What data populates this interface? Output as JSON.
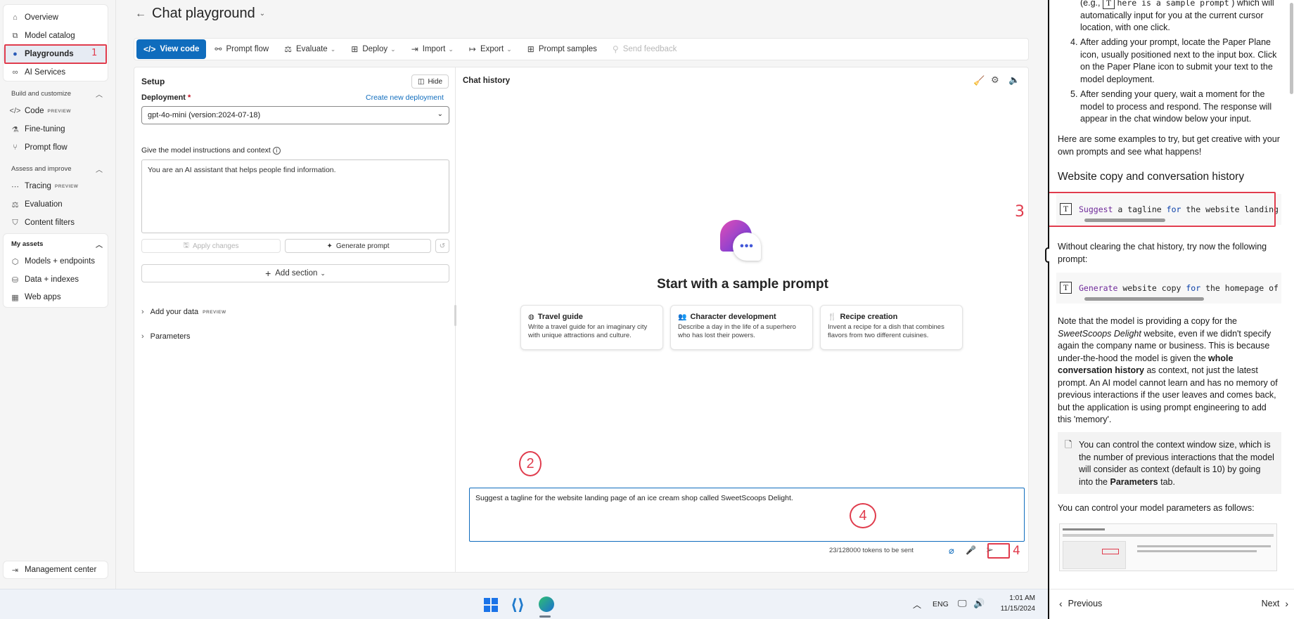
{
  "sidebar": {
    "top_items": [
      {
        "label": "Overview",
        "icon": "home-icon"
      },
      {
        "label": "Model catalog",
        "icon": "cube-icon"
      },
      {
        "label": "Playgrounds",
        "icon": "chat-bubbles-icon"
      },
      {
        "label": "AI Services",
        "icon": "link-icon"
      }
    ],
    "build_section": "Build and customize",
    "build_items": [
      {
        "label": "Code",
        "badge": "PREVIEW"
      },
      {
        "label": "Fine-tuning"
      },
      {
        "label": "Prompt flow"
      }
    ],
    "assess_section": "Assess and improve",
    "assess_items": [
      {
        "label": "Tracing",
        "badge": "PREVIEW"
      },
      {
        "label": "Evaluation"
      },
      {
        "label": "Content filters"
      }
    ],
    "assets_section": "My assets",
    "assets_items": [
      {
        "label": "Models + endpoints"
      },
      {
        "label": "Data + indexes"
      },
      {
        "label": "Web apps"
      }
    ],
    "management": "Management center"
  },
  "header": {
    "title": "Chat playground"
  },
  "toolbar": {
    "view_code": "View code",
    "prompt_flow": "Prompt flow",
    "evaluate": "Evaluate",
    "deploy": "Deploy",
    "import": "Import",
    "export": "Export",
    "prompt_samples": "Prompt samples",
    "send_feedback": "Send feedback"
  },
  "setup": {
    "title": "Setup",
    "hide": "Hide",
    "deployment_label": "Deployment",
    "required_mark": "*",
    "create_new": "Create new deployment",
    "deployment_value": "gpt-4o-mini (version:2024-07-18)",
    "instructions_label": "Give the model instructions and context",
    "instructions_value": "You are an AI assistant that helps people find information.",
    "apply_changes": "Apply changes",
    "generate_prompt": "Generate prompt",
    "add_section": "Add section",
    "add_your_data": "Add your data",
    "add_data_badge": "PREVIEW",
    "parameters": "Parameters"
  },
  "chat": {
    "title": "Chat history",
    "start_heading": "Start with a sample prompt",
    "samples": [
      {
        "title": "Travel guide",
        "desc": "Write a travel guide for an imaginary city with unique attractions and culture."
      },
      {
        "title": "Character development",
        "desc": "Describe a day in the life of a superhero who has lost their powers."
      },
      {
        "title": "Recipe creation",
        "desc": "Invent a recipe for a dish that combines flavors from two different cuisines."
      }
    ],
    "input_value": "Suggest a tagline for the website landing page of an ice cream shop called SweetScoops Delight.",
    "tokens": "23/128000 tokens to be sent"
  },
  "annotations": {
    "n1": "1",
    "n2": "2",
    "n3": "3",
    "n4a": "4",
    "n4b": "4",
    "color": "#e03c4d"
  },
  "taskbar": {
    "lang": "ENG",
    "time": "1:01 AM",
    "date": "11/15/2024"
  },
  "pane": {
    "step3_pre": "(e.g.,",
    "step3_code": "here is a sample prompt",
    "step3_post": ") which will automatically input for you at the current cursor location, with one click.",
    "step4": "After adding your prompt, locate the Paper Plane icon, usually positioned next to the input box. Click on the Paper Plane icon to submit your text to the model deployment.",
    "step5": "After sending your query, wait a moment for the model to process and respond. The response will appear in the chat window below your input.",
    "examples_intro": "Here are some examples to try, but get creative with your own prompts and see what happens!",
    "heading": "Website copy and conversation history",
    "code1_w1": "Suggest",
    "code1_rest": "a tagline",
    "code1_for": "for",
    "code1_tail": "the website landing",
    "without_clearing": "Without clearing the chat history, try now the following prompt:",
    "code2_w1": "Generate",
    "code2_rest": "website copy",
    "code2_for": "for",
    "code2_tail": "the homepage of",
    "note_a": "Note that the model is providing a copy for the",
    "note_em": "SweetScoops Delight",
    "note_b": "website, even if we didn't specify again the company name or business. This is because under-the-hood the model is given the",
    "note_strong": "whole conversation history",
    "note_c": "as context, not just the latest prompt. An AI model cannot learn and has no memory of previous interactions if the user leaves and comes back, but the application is using prompt engineering to add this 'memory'.",
    "callout_a": "You can control the context window size, which is the number of previous interactions that the model will consider as context (default is 10) by going into the",
    "callout_strong": "Parameters",
    "callout_b": "tab.",
    "params_text": "You can control your model parameters as follows:",
    "previous": "Previous",
    "next": "Next"
  }
}
